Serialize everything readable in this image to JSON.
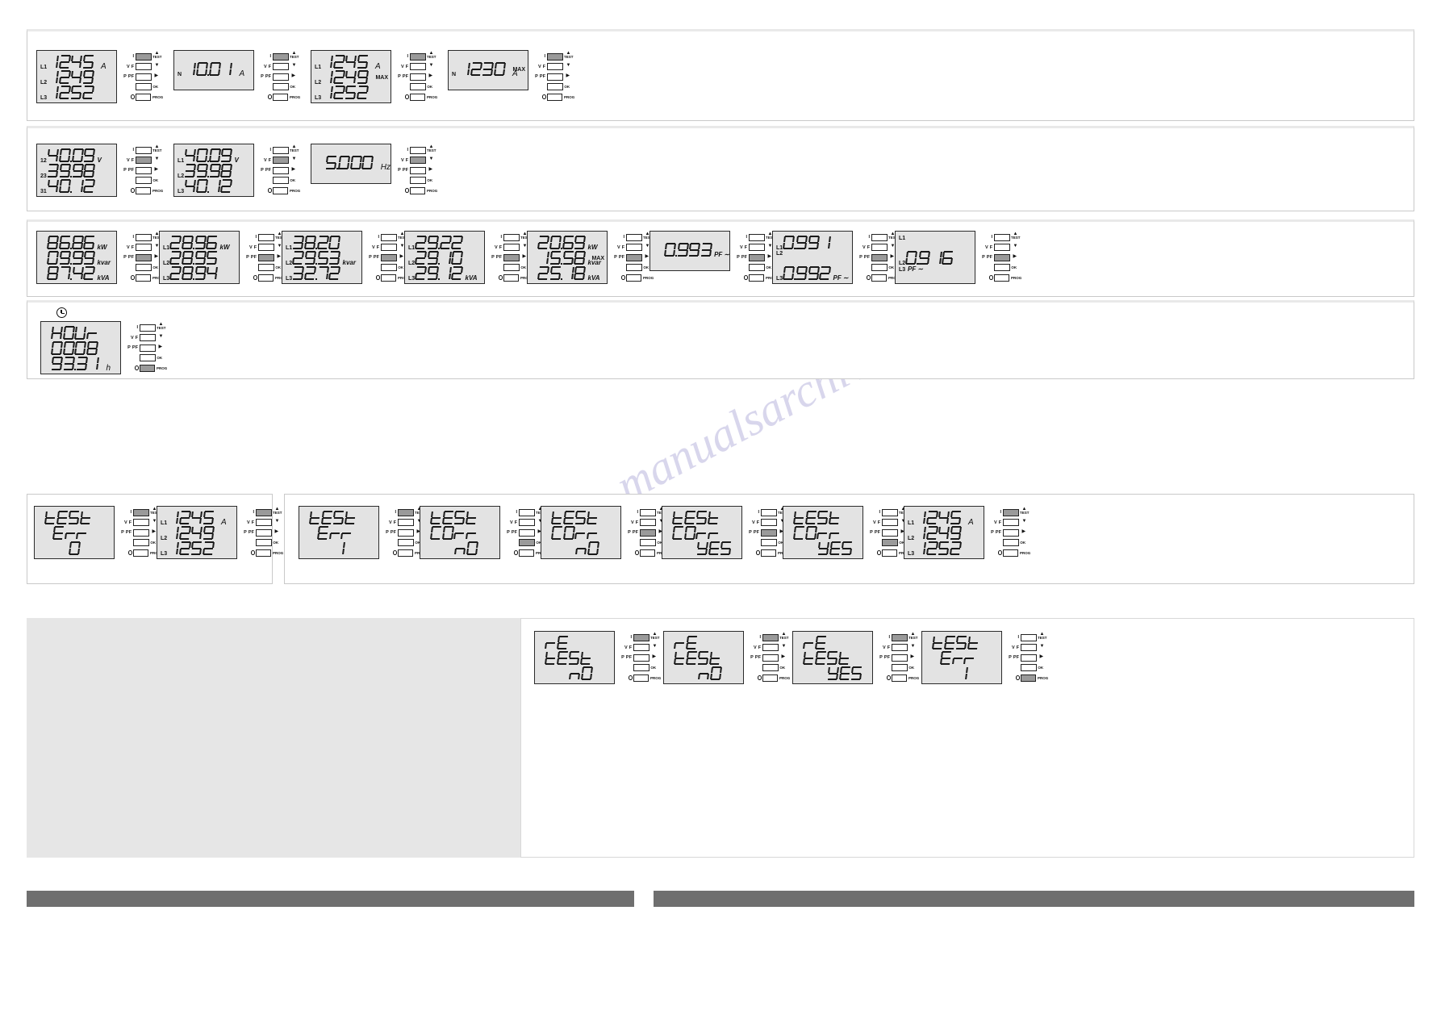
{
  "meta": {
    "watermark": "manualsarchive.com",
    "display_unit_A": "A",
    "display_unit_V": "V",
    "display_unit_Hz": "Hz",
    "display_unit_h": "h",
    "max_tag": "MAX"
  },
  "keypad": {
    "labels": {
      "i": "I",
      "v": "V",
      "f": "F",
      "p": "P",
      "pf": "PF"
    },
    "marks": {
      "test": "TEST",
      "ok": "OK",
      "prog": "PROG"
    },
    "arrows": {
      "up": "▲",
      "down": "▼",
      "right": "▶"
    }
  },
  "sections": {
    "current": {
      "meters": [
        {
          "rows": [
            {
              "phase": "L1",
              "value": "1245",
              "unit_big": "A"
            },
            {
              "phase": "L2",
              "value": "1249"
            },
            {
              "phase": "L3",
              "value": "1252"
            }
          ],
          "active_key": "i"
        },
        {
          "rows": [
            {
              "phase": "N",
              "value": "1001",
              "unit_big": "A",
              "dp_after": 2
            }
          ],
          "active_key": "i",
          "single": true
        },
        {
          "rows": [
            {
              "phase": "L1",
              "value": "1245",
              "unit_big": "A"
            },
            {
              "phase": "L2",
              "value": "1249",
              "max": "MAX"
            },
            {
              "phase": "L3",
              "value": "1252"
            }
          ],
          "active_key": "i"
        },
        {
          "rows": [
            {
              "phase": "N",
              "value": "1230",
              "unit_big": "A",
              "max": "MAX"
            }
          ],
          "active_key": "i",
          "single": true
        }
      ]
    },
    "voltage": {
      "meters": [
        {
          "rows": [
            {
              "phase": "12",
              "value": "4009",
              "unit": "V",
              "dp_after": 2
            },
            {
              "phase": "23",
              "value": "3998",
              "dp_after": 2
            },
            {
              "phase": "31",
              "value": "4012",
              "dp_after": 2
            }
          ],
          "active_key": "vf"
        },
        {
          "rows": [
            {
              "phase": "L1",
              "value": "4009",
              "unit": "V",
              "dp_after": 2
            },
            {
              "phase": "L2",
              "value": "3998",
              "dp_after": 2
            },
            {
              "phase": "L3",
              "value": "4012",
              "dp_after": 2
            }
          ],
          "active_key": "vf"
        },
        {
          "rows": [
            {
              "phase": "",
              "value": "5000",
              "unit_big": "Hz",
              "dp_after": 1
            }
          ],
          "active_key": "vf",
          "single": true
        }
      ]
    },
    "power": {
      "meters": [
        {
          "rows": [
            {
              "phase": "",
              "value": "8686",
              "unit": "kW",
              "dp_after": 2
            },
            {
              "phase": "",
              "value": "0999",
              "unit": "kvar",
              "dp_after": 2
            },
            {
              "phase": "",
              "value": "8742",
              "unit": "kVA",
              "dp_after": 2
            }
          ],
          "active_key": "ppf"
        },
        {
          "rows": [
            {
              "phase": "L1",
              "value": "2896",
              "unit": "kW",
              "dp_after": 2
            },
            {
              "phase": "L2",
              "value": "2895",
              "dp_after": 2
            },
            {
              "phase": "L3",
              "value": "2894",
              "dp_after": 2
            }
          ],
          "active_key": "ppf"
        },
        {
          "rows": [
            {
              "phase": "L1",
              "value": "3820",
              "dp_after": 2
            },
            {
              "phase": "L2",
              "value": "2953",
              "unit": "kvar",
              "dp_after": 2
            },
            {
              "phase": "L3",
              "value": "3272",
              "dp_after": 2
            }
          ],
          "active_key": "ppf"
        },
        {
          "rows": [
            {
              "phase": "L1",
              "value": "2922",
              "dp_after": 2
            },
            {
              "phase": "L2",
              "value": "2910",
              "dp_after": 2
            },
            {
              "phase": "L3",
              "value": "2912",
              "unit": "kVA",
              "dp_after": 2
            }
          ],
          "active_key": "ppf"
        },
        {
          "rows": [
            {
              "phase": "",
              "value": "2069",
              "unit": "kW",
              "dp_after": 2
            },
            {
              "phase": "",
              "value": "1558",
              "unit": "kvar",
              "dp_after": 2,
              "max": "MAX"
            },
            {
              "phase": "",
              "value": "2518",
              "unit": "kVA",
              "dp_after": 2
            }
          ],
          "active_key": "ppf"
        },
        {
          "rows": [
            {
              "phase": "",
              "value": "0993",
              "unit": "PF",
              "lead_lag": true,
              "dp_after": 1,
              "bottom": true
            }
          ],
          "active_key": "ppf",
          "single": true
        },
        {
          "rows": [
            {
              "phase": "L1",
              "value": "0991",
              "dp_after": 1
            },
            {
              "phase": "L2",
              "value": ""
            },
            {
              "phase": "L3",
              "value": "0992",
              "unit": "PF",
              "lead_lag": true,
              "dp_after": 1
            }
          ],
          "active_key": "ppf"
        },
        {
          "rows": [
            {
              "phase": "L1",
              "value": ""
            },
            {
              "phase": "L2",
              "value": "0916",
              "dp_after": 1
            },
            {
              "phase": "L3",
              "value": "",
              "unit": "PF",
              "lead_lag": true
            }
          ],
          "active_key": "ppf"
        }
      ]
    },
    "hours": {
      "icon": "clock-icon",
      "meters": [
        {
          "rows": [
            {
              "phase": "",
              "text": "HOUr"
            },
            {
              "phase": "",
              "value": "0008"
            },
            {
              "phase": "",
              "value": "9331",
              "unit_big": "h",
              "dp_after": 2
            }
          ],
          "active_key": "prog"
        }
      ]
    },
    "test_left": {
      "meters": [
        {
          "rows": [
            {
              "phase": "",
              "text": "tESt"
            },
            {
              "phase": "",
              "text": "Err",
              "indent": true
            },
            {
              "phase": "",
              "value": "0",
              "align_right": true
            }
          ],
          "active_key": "i"
        },
        {
          "rows": [
            {
              "phase": "L1",
              "value": "1245",
              "unit_big": "A"
            },
            {
              "phase": "L2",
              "value": "1249"
            },
            {
              "phase": "L3",
              "value": "1252"
            }
          ],
          "active_key": "i"
        }
      ]
    },
    "test_right": {
      "meters": [
        {
          "rows": [
            {
              "phase": "",
              "text": "tESt"
            },
            {
              "phase": "",
              "text": "Err",
              "indent": true
            },
            {
              "phase": "",
              "value": "1",
              "align_right": true
            }
          ],
          "active_key": "i"
        },
        {
          "rows": [
            {
              "phase": "",
              "text": "tESt"
            },
            {
              "phase": "",
              "text": "COrr"
            },
            {
              "phase": "",
              "text": "nO",
              "align_right": true
            }
          ],
          "active_key": "ok"
        },
        {
          "rows": [
            {
              "phase": "",
              "text": "tESt"
            },
            {
              "phase": "",
              "text": "COrr"
            },
            {
              "phase": "",
              "text": "nO",
              "align_right": true
            }
          ],
          "active_key": "ppf"
        },
        {
          "rows": [
            {
              "phase": "",
              "text": "tESt"
            },
            {
              "phase": "",
              "text": "COrr"
            },
            {
              "phase": "",
              "text": "YES",
              "align_right": true
            }
          ],
          "active_key": "ppf"
        },
        {
          "rows": [
            {
              "phase": "",
              "text": "tESt"
            },
            {
              "phase": "",
              "text": "COrr"
            },
            {
              "phase": "",
              "text": "YES",
              "align_right": true
            }
          ],
          "active_key": "ok"
        },
        {
          "rows": [
            {
              "phase": "L1",
              "value": "1245",
              "unit_big": "A"
            },
            {
              "phase": "L2",
              "value": "1249"
            },
            {
              "phase": "L3",
              "value": "1252"
            }
          ],
          "active_key": "i"
        }
      ]
    },
    "retest": {
      "meters": [
        {
          "rows": [
            {
              "phase": "",
              "text": "rE"
            },
            {
              "phase": "",
              "text": "tESt"
            },
            {
              "phase": "",
              "text": "nO",
              "align_right": true
            }
          ],
          "active_key": "i"
        },
        {
          "rows": [
            {
              "phase": "",
              "text": "rE"
            },
            {
              "phase": "",
              "text": "tESt"
            },
            {
              "phase": "",
              "text": "nO",
              "align_right": true
            }
          ],
          "active_key": "i"
        },
        {
          "rows": [
            {
              "phase": "",
              "text": "rE"
            },
            {
              "phase": "",
              "text": "tESt"
            },
            {
              "phase": "",
              "text": "YES",
              "align_right": true
            }
          ],
          "active_key": "i"
        },
        {
          "rows": [
            {
              "phase": "",
              "text": "tESt"
            },
            {
              "phase": "",
              "text": "Err",
              "indent": true
            },
            {
              "phase": "",
              "value": "1",
              "align_right": true
            }
          ],
          "active_key": "prog"
        }
      ]
    }
  },
  "footer": {
    "bar_left": "",
    "bar_right": ""
  }
}
